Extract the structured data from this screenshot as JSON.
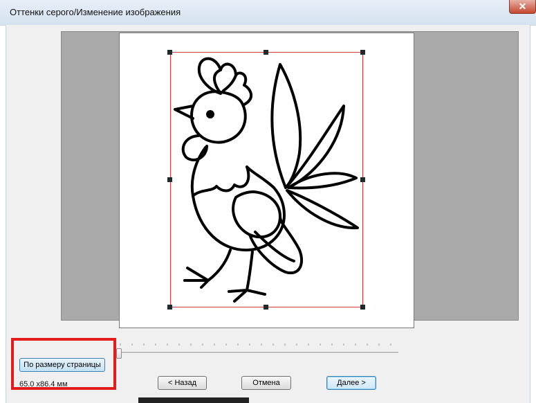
{
  "window": {
    "title": "Оттенки серого/Изменение изображения",
    "close_glyph": "✕"
  },
  "preview": {
    "image_subject": "rooster coloring-page drawing",
    "selection_color": "#d23a3a"
  },
  "controls": {
    "fit_to_page_label": "По размеру страницы",
    "size_text": "65.0 x86.4 мм",
    "zoom_slider_value": 0
  },
  "buttons": {
    "back_label": "< Назад",
    "cancel_label": "Отмена",
    "next_label": "Далее >"
  },
  "annotation": {
    "highlight_color": "#e31b1b"
  }
}
